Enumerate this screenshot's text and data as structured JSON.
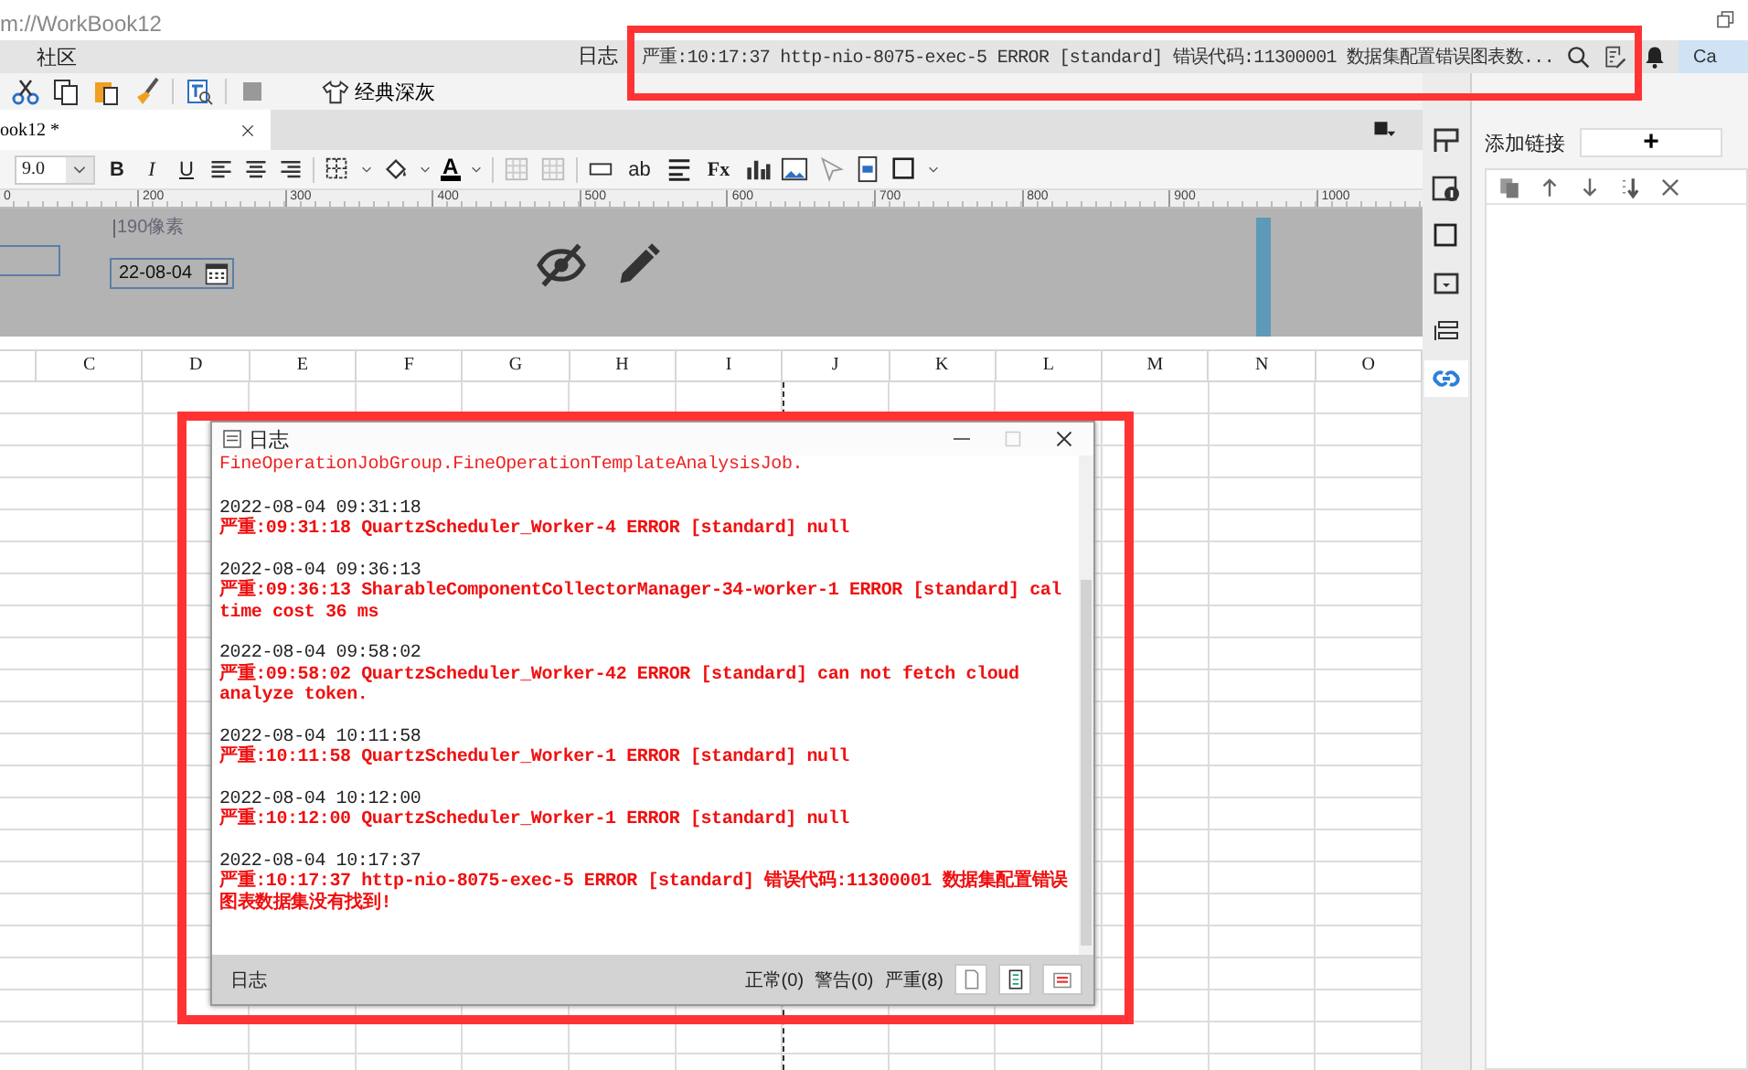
{
  "window": {
    "address": "m://WorkBook12"
  },
  "menu": {
    "items": [
      {
        "label": "社区"
      }
    ]
  },
  "status": {
    "label": "日志",
    "message": "严重:10:17:37 http-nio-8075-exec-5 ERROR [standard] 错误代码:11300001 数据集配置错误图表数...",
    "account": "Ca"
  },
  "toolbar": {
    "theme_button": "经典深灰"
  },
  "tabs": [
    {
      "label": "ook12 *",
      "selected": true
    }
  ],
  "format_bar": {
    "font_size": "9.0",
    "style_buttons": [
      "B",
      "I",
      "U"
    ],
    "font_color": "A",
    "text_field": "ab",
    "formula": "Fx"
  },
  "ruler": {
    "labels": [
      "0",
      "200",
      "300",
      "400",
      "500",
      "600",
      "700",
      "800",
      "900",
      "1000"
    ]
  },
  "parameter_panel": {
    "width_label": "190像素",
    "date_value": "22-08-04"
  },
  "sheet": {
    "columns": [
      "C",
      "D",
      "E",
      "F",
      "G",
      "H",
      "I",
      "J",
      "K",
      "L",
      "M",
      "N",
      "O"
    ]
  },
  "log_dialog": {
    "title": "日志",
    "fragment": "FineOperationJobGroup.FineOperationTemplateAnalysisJob.",
    "entries": [
      {
        "time": "2022-08-04 09:31:18",
        "message": "严重:09:31:18 QuartzScheduler_Worker-4 ERROR [standard] null"
      },
      {
        "time": "2022-08-04 09:36:13",
        "message": "严重:09:36:13 SharableComponentCollectorManager-34-worker-1 ERROR [standard] cal time cost 36 ms"
      },
      {
        "time": "2022-08-04 09:58:02",
        "message": "严重:09:58:02 QuartzScheduler_Worker-42 ERROR [standard] can not fetch cloud analyze token."
      },
      {
        "time": "2022-08-04 10:11:58",
        "message": "严重:10:11:58 QuartzScheduler_Worker-1 ERROR [standard] null"
      },
      {
        "time": "2022-08-04 10:12:00",
        "message": "严重:10:12:00 QuartzScheduler_Worker-1 ERROR [standard] null"
      },
      {
        "time": "2022-08-04 10:17:37",
        "message": "严重:10:17:37 http-nio-8075-exec-5 ERROR [standard] 错误代码:11300001 数据集配置错误图表数据集没有找到!"
      }
    ],
    "footer": {
      "label": "日志",
      "counts": [
        "正常(0)",
        "警告(0)",
        "严重(8)"
      ]
    }
  },
  "side_tabs": [
    {
      "selected": false
    },
    {
      "selected": false
    },
    {
      "selected": false
    },
    {
      "selected": false
    },
    {
      "selected": false
    },
    {
      "selected": true
    }
  ],
  "side_panel": {
    "add_label": "添加链接",
    "add_button": "+"
  }
}
